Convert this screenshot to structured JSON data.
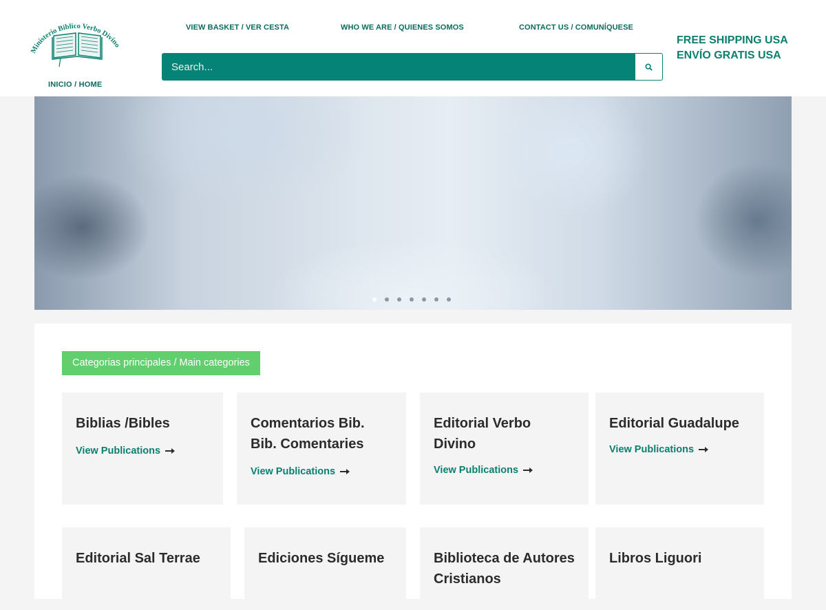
{
  "header": {
    "logo_text": "Ministerio Biblico Verbo Divino",
    "home_label": "INICIO / HOME",
    "nav": [
      {
        "label": "VIEW BASKET / VER CESTA"
      },
      {
        "label": "WHO WE ARE / QUIENES SOMOS"
      },
      {
        "label": "CONTACT US / COMUNÍQUESE"
      }
    ],
    "search": {
      "placeholder": "Search..."
    },
    "shipping": [
      "FREE SHIPPING USA",
      "ENVÍO GRATIS USA"
    ]
  },
  "hero": {
    "slide_count": 7,
    "active_slide": 1
  },
  "categories": {
    "heading": "Categorias principales / Main categories",
    "link_label": "View Publications",
    "items": [
      {
        "title": "Biblias /Bibles"
      },
      {
        "title": "Comentarios Bib. Bib. Comentaries"
      },
      {
        "title": "Editorial Verbo Divino"
      },
      {
        "title": "Editorial Guadalupe"
      },
      {
        "title": "Editorial Sal Terrae"
      },
      {
        "title": "Ediciones Sígueme"
      },
      {
        "title": "Biblioteca de Autores Cristianos"
      },
      {
        "title": "Libros Liguori"
      }
    ]
  },
  "colors": {
    "brand_teal": "#058376",
    "link_teal": "#0b7f6e",
    "category_badge": "#62cf6f"
  }
}
